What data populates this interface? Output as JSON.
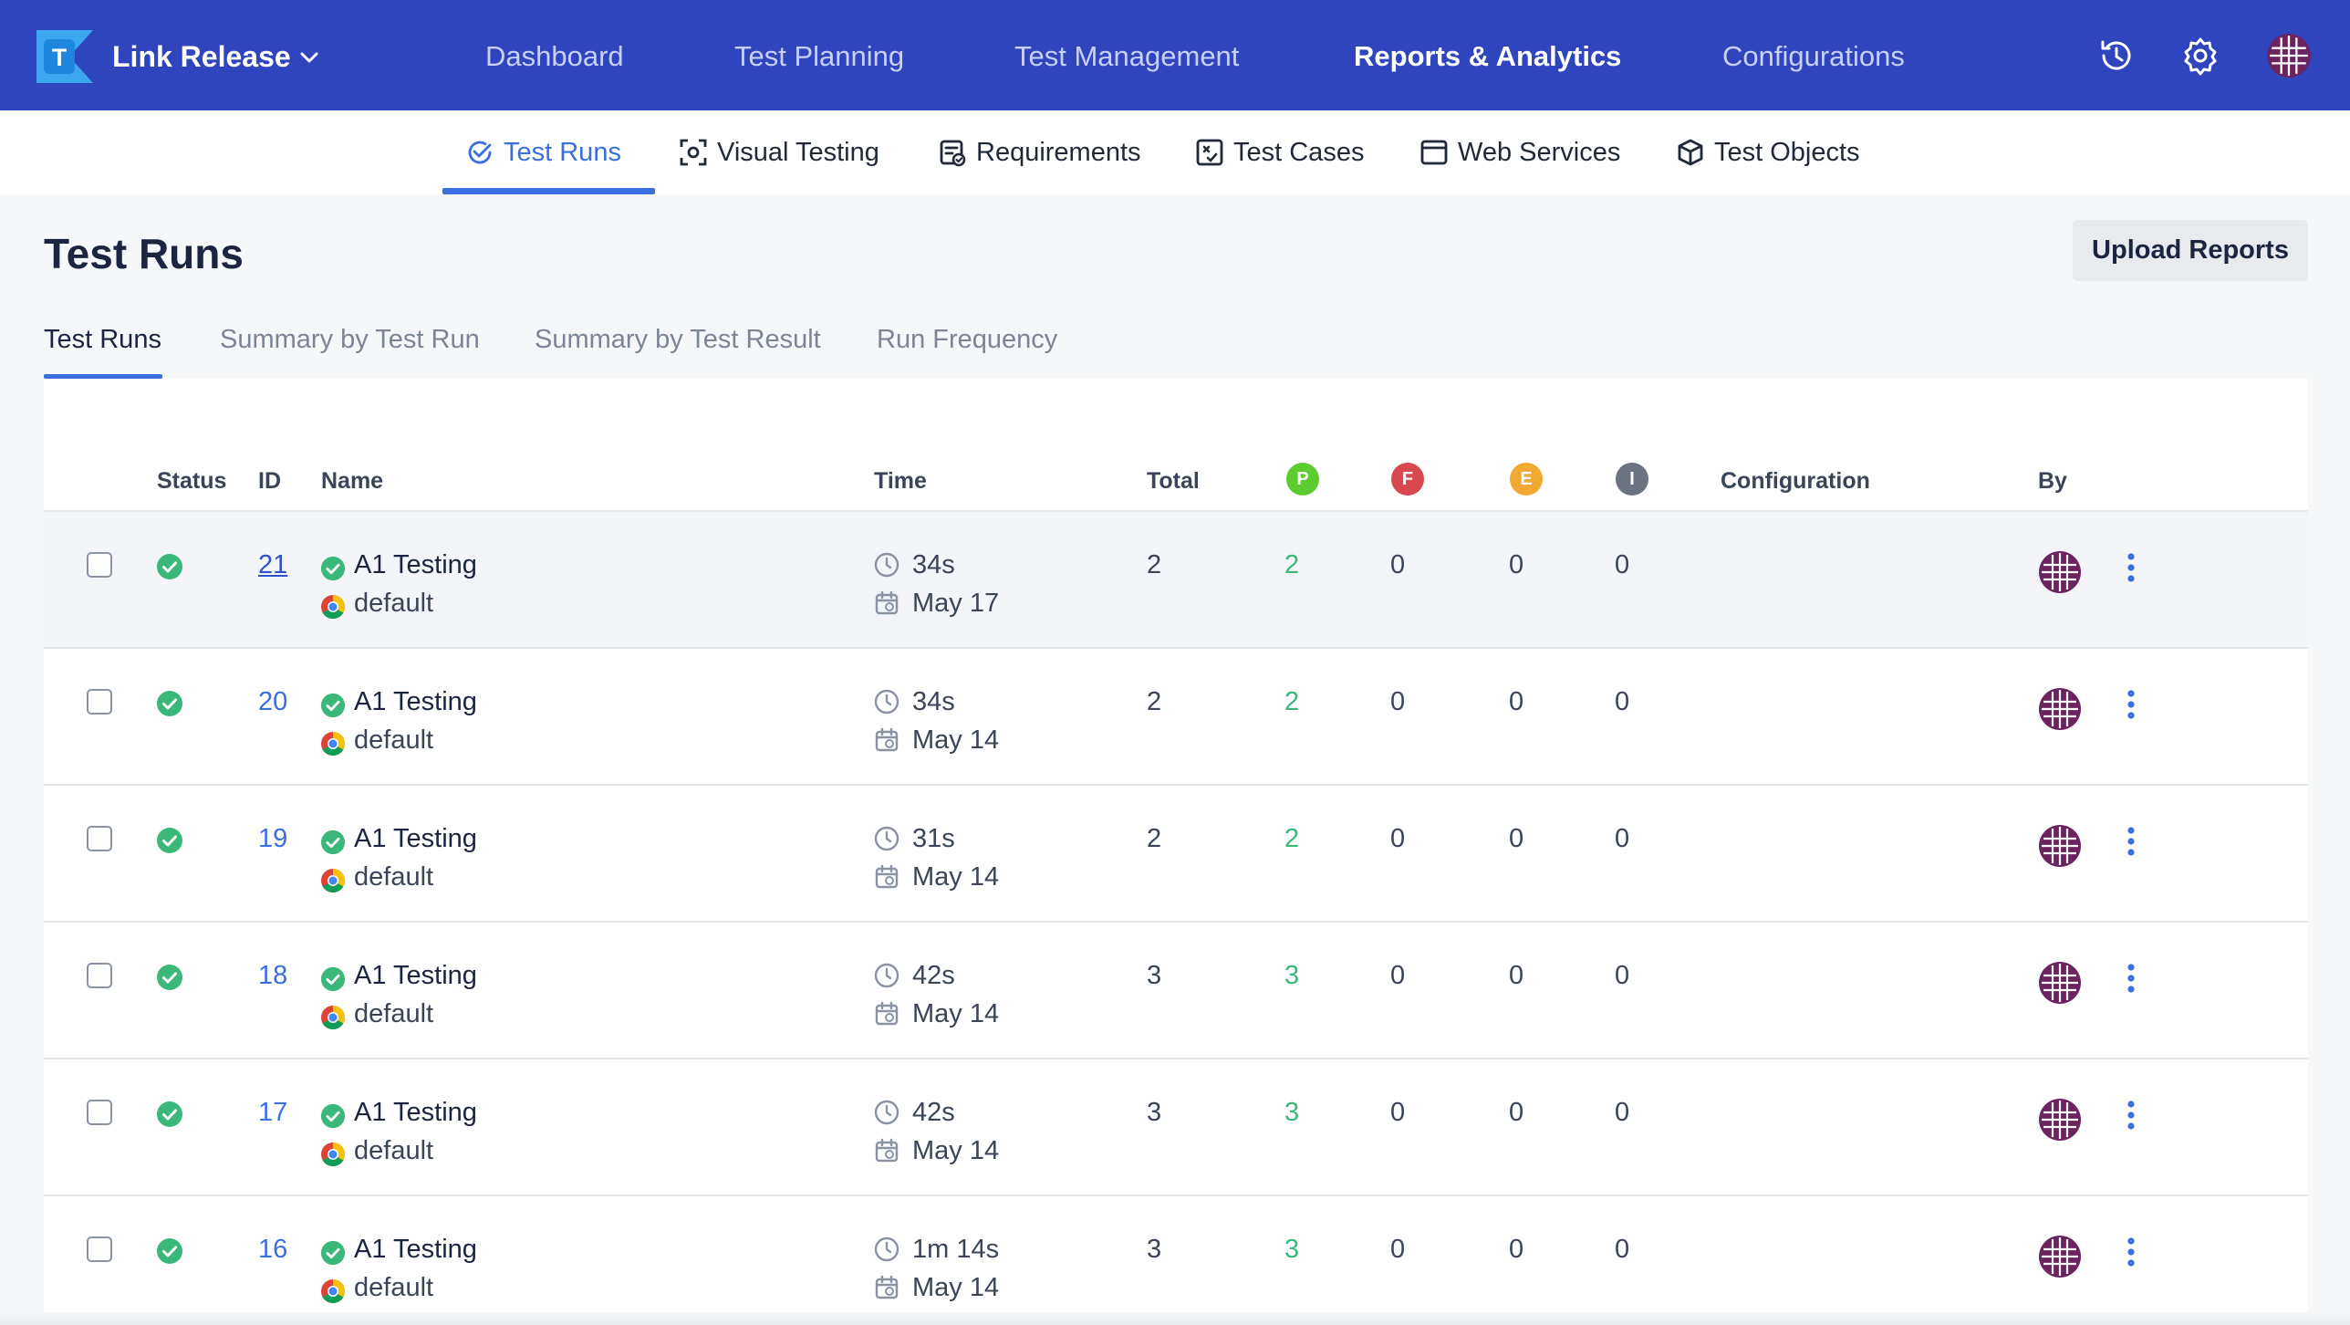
{
  "app": {
    "project_name": "Link Release",
    "logo_letter": "T",
    "brand_color": "#2e45bd",
    "accent_color": "#3b6fe0"
  },
  "nav": {
    "items": [
      "Dashboard",
      "Test Planning",
      "Test Management",
      "Reports & Analytics",
      "Configurations"
    ],
    "active": "Reports & Analytics",
    "icons": [
      "history-icon",
      "settings-gear-icon",
      "user-avatar"
    ]
  },
  "subnav": {
    "items": [
      {
        "label": "Test Runs",
        "icon": "check-circle-icon"
      },
      {
        "label": "Visual Testing",
        "icon": "focus-frame-icon"
      },
      {
        "label": "Requirements",
        "icon": "requirement-doc-icon"
      },
      {
        "label": "Test Cases",
        "icon": "test-case-icon"
      },
      {
        "label": "Web Services",
        "icon": "window-icon"
      },
      {
        "label": "Test Objects",
        "icon": "cube-icon"
      }
    ],
    "active": "Test Runs"
  },
  "page": {
    "title": "Test Runs",
    "upload_label": "Upload Reports",
    "tabs": [
      "Test Runs",
      "Summary by Test Run",
      "Summary by Test Result",
      "Run Frequency"
    ],
    "active_tab": "Test Runs"
  },
  "table": {
    "headers": {
      "status": "Status",
      "id": "ID",
      "name": "Name",
      "time": "Time",
      "total": "Total",
      "passed": "P",
      "failed": "F",
      "error": "E",
      "incomplete": "I",
      "configuration": "Configuration",
      "by": "By"
    },
    "badge_colors": {
      "passed": "#5ccc2f",
      "failed": "#d9484f",
      "error": "#f0a931",
      "incomplete": "#6b7280"
    },
    "rows": [
      {
        "id": "21",
        "name": "A1 Testing",
        "config": "default",
        "duration": "34s",
        "date": "May 17",
        "total": "2",
        "passed": "2",
        "failed": "0",
        "error": "0",
        "incomplete": "0"
      },
      {
        "id": "20",
        "name": "A1 Testing",
        "config": "default",
        "duration": "34s",
        "date": "May 14",
        "total": "2",
        "passed": "2",
        "failed": "0",
        "error": "0",
        "incomplete": "0"
      },
      {
        "id": "19",
        "name": "A1 Testing",
        "config": "default",
        "duration": "31s",
        "date": "May 14",
        "total": "2",
        "passed": "2",
        "failed": "0",
        "error": "0",
        "incomplete": "0"
      },
      {
        "id": "18",
        "name": "A1 Testing",
        "config": "default",
        "duration": "42s",
        "date": "May 14",
        "total": "3",
        "passed": "3",
        "failed": "0",
        "error": "0",
        "incomplete": "0"
      },
      {
        "id": "17",
        "name": "A1 Testing",
        "config": "default",
        "duration": "42s",
        "date": "May 14",
        "total": "3",
        "passed": "3",
        "failed": "0",
        "error": "0",
        "incomplete": "0"
      },
      {
        "id": "16",
        "name": "A1 Testing",
        "config": "default",
        "duration": "1m 14s",
        "date": "May 14",
        "total": "3",
        "passed": "3",
        "failed": "0",
        "error": "0",
        "incomplete": "0"
      }
    ]
  }
}
